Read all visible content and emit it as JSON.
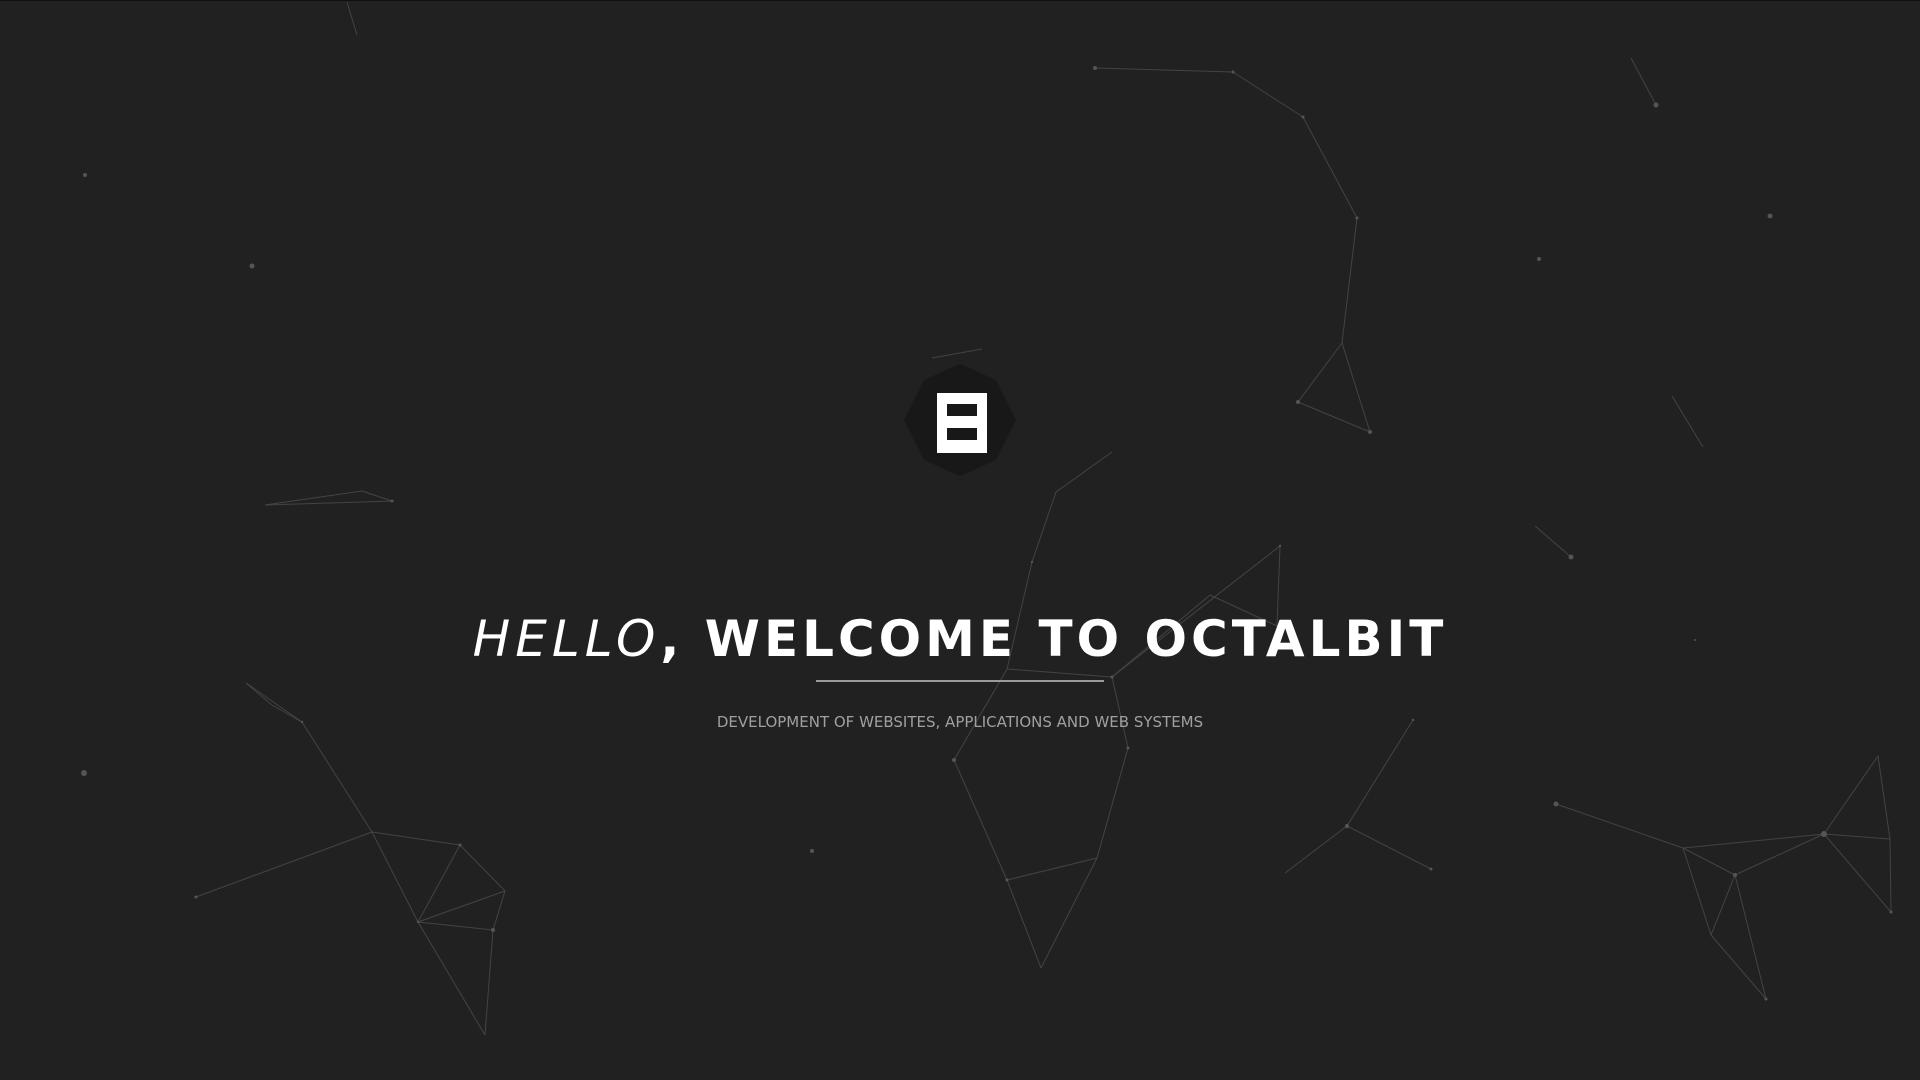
{
  "colors": {
    "background": "#212121",
    "title": "#ffffff",
    "tagline": "#a0a0a0",
    "network_lines": "#4a4a4a",
    "logo_badge": "#181818"
  },
  "logo": {
    "icon": "octalbit-logo-icon"
  },
  "hero": {
    "title_hello": "HELLO",
    "title_rest": ", WELCOME TO OCTALBIT",
    "tagline": "DEVELOPMENT OF WEBSITES, APPLICATIONS AND WEB SYSTEMS"
  }
}
